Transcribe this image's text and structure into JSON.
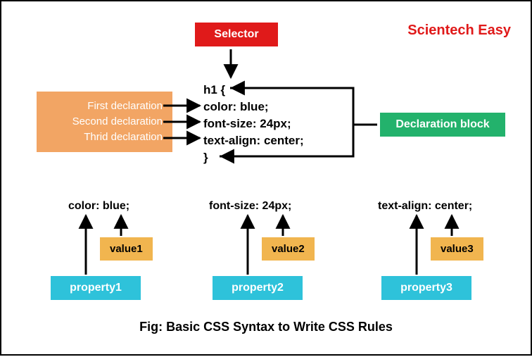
{
  "brand": "Scientech Easy",
  "labels": {
    "selector": "Selector",
    "declBlock": "Declaration block",
    "first": "First declaration",
    "second": "Second declaration",
    "third": "Thrid declaration"
  },
  "code": {
    "l1": "h1 {",
    "l2": "color: blue;",
    "l3": "font-size: 24px;",
    "l4": "text-align: center;",
    "l5": "}"
  },
  "examples": {
    "e1": "color: blue;",
    "e2": "font-size: 24px;",
    "e3": "text-align: center;"
  },
  "props": {
    "p1": "property1",
    "p2": "property2",
    "p3": "property3",
    "v1": "value1",
    "v2": "value2",
    "v3": "value3"
  },
  "caption": "Fig: Basic CSS Syntax to Write CSS Rules"
}
